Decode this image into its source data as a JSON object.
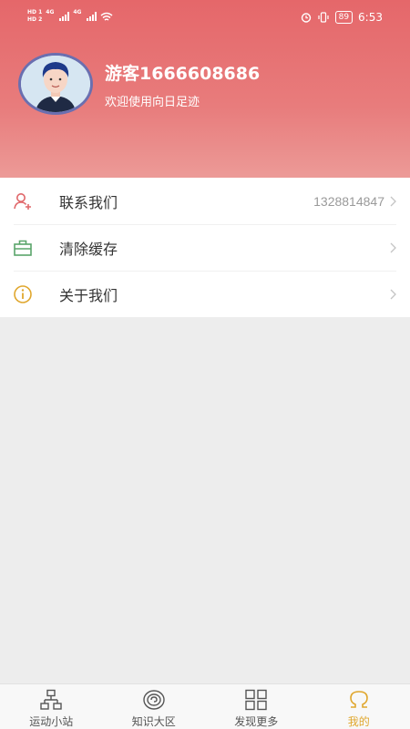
{
  "status_bar": {
    "hd1": "HD 1",
    "hd2": "HD 2",
    "net1": "4G",
    "net2": "4G",
    "battery": "89",
    "time": "6:53"
  },
  "profile": {
    "username": "游客1666608686",
    "welcome": "欢迎使用向日足迹"
  },
  "menu": {
    "items": [
      {
        "label": "联系我们",
        "value": "1328814847",
        "icon": "contact-person-icon",
        "color": "#e0676a"
      },
      {
        "label": "清除缓存",
        "value": "",
        "icon": "toolbox-icon",
        "color": "#5aa56a"
      },
      {
        "label": "关于我们",
        "value": "",
        "icon": "info-icon",
        "color": "#e0a72e"
      }
    ]
  },
  "tabbar": {
    "tabs": [
      {
        "label": "运动小站",
        "icon": "network-icon",
        "active": false
      },
      {
        "label": "知识大区",
        "icon": "spiral-icon",
        "active": false
      },
      {
        "label": "发现更多",
        "icon": "grid-icon",
        "active": false
      },
      {
        "label": "我的",
        "icon": "omega-icon",
        "active": true
      }
    ]
  },
  "colors": {
    "header_start": "#e5676a",
    "header_end": "#ec9a97",
    "accent": "#e0a72e",
    "background": "#ededed"
  }
}
